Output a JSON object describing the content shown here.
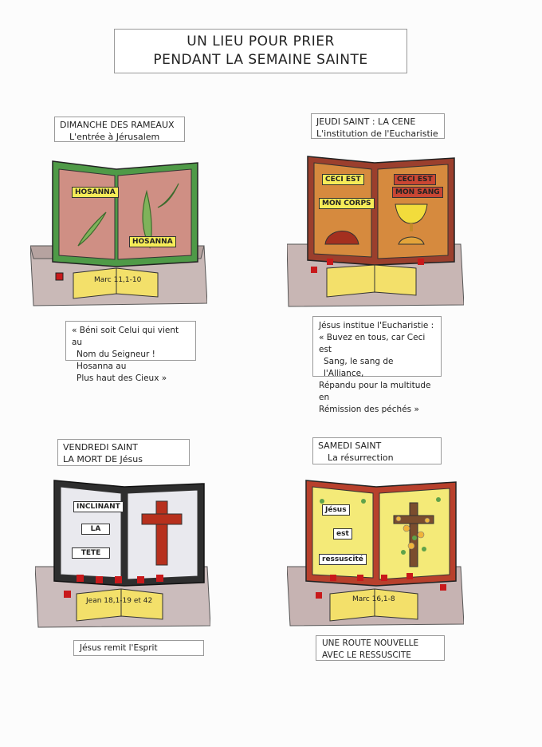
{
  "title": {
    "line1": "UN LIEU POUR PRIER",
    "line2": "PENDANT LA SEMAINE SAINTE"
  },
  "panels": {
    "rameaux": {
      "label1": "DIMANCHE DES RAMEAUX",
      "label2": "L'entrée à Jérusalem",
      "tag_left": "HOSANNA",
      "tag_right": "HOSANNA",
      "ref": "Marc 11,1-10",
      "quote": [
        "« Béni soit Celui qui vient au",
        "Nom du Seigneur ! Hosanna au",
        "Plus haut des Cieux »"
      ],
      "book_color": "#4f9a47",
      "page_color": "#cf8f84"
    },
    "cene": {
      "label1": "JEUDI SAINT : LA CENE",
      "label2": "L'institution de l'Eucharistie",
      "tag_1": "CECI EST",
      "tag_2": "MON CORPS",
      "tag_3": "CECI EST",
      "tag_4": "MON SANG",
      "quote": [
        "Jésus institue l'Eucharistie :",
        "« Buvez en tous, car Ceci est",
        "Sang, le sang de l'Alliance,",
        "Répandu pour la multitude en",
        "Rémission des péchés »"
      ],
      "book_color": "#9b3f2d",
      "page_color": "#d68a3e"
    },
    "vendredi": {
      "label1": "VENDREDI SAINT",
      "label2": "LA MORT DE Jésus",
      "tag_1": "INCLINANT",
      "tag_2": "LA",
      "tag_3": "TETE",
      "ref": "Jean 18,1-19 et 42",
      "quote": [
        "Jésus remit l'Esprit"
      ],
      "book_color": "#2e2e2e",
      "page_color": "#e9e9ee"
    },
    "samedi": {
      "label1": "SAMEDI SAINT",
      "label2": "La résurrection",
      "tag_1": "Jésus",
      "tag_2": "est",
      "tag_3": "ressuscité",
      "ref": "Marc 16,1-8",
      "quote": [
        "UNE ROUTE NOUVELLE",
        "AVEC LE RESSUSCITE"
      ],
      "book_color": "#b8402c",
      "page_color": "#f4ea78"
    }
  }
}
